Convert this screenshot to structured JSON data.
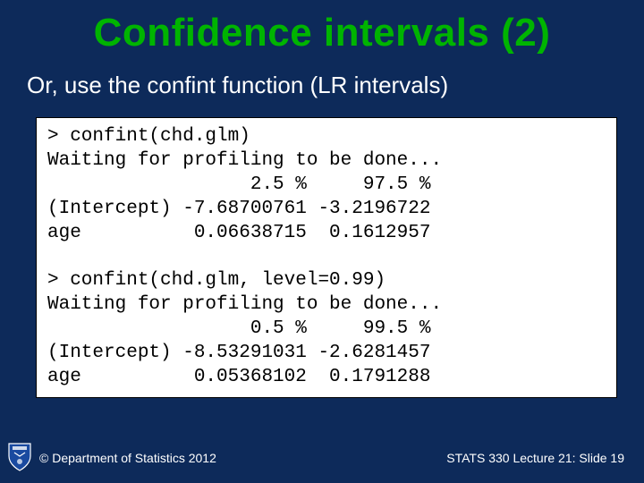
{
  "title": "Confidence intervals (2)",
  "subtitle": "Or, use the confint function (LR intervals)",
  "code": "> confint(chd.glm)\nWaiting for profiling to be done...\n                  2.5 %     97.5 %\n(Intercept) -7.68700761 -3.2196722\nage          0.06638715  0.1612957\n\n> confint(chd.glm, level=0.99)\nWaiting for profiling to be done...\n                  0.5 %     99.5 %\n(Intercept) -8.53291031 -2.6281457\nage          0.05368102  0.1791288",
  "footer": {
    "copyright": "© Department of Statistics 2012",
    "slideinfo": "STATS 330 Lecture 21: Slide 19"
  },
  "chart_data": [
    {
      "type": "table",
      "title": "confint(chd.glm)",
      "columns": [
        "2.5 %",
        "97.5 %"
      ],
      "rows": [
        {
          "name": "(Intercept)",
          "values": [
            -7.68700761,
            -3.2196722
          ]
        },
        {
          "name": "age",
          "values": [
            0.06638715,
            0.1612957
          ]
        }
      ]
    },
    {
      "type": "table",
      "title": "confint(chd.glm, level=0.99)",
      "columns": [
        "0.5 %",
        "99.5 %"
      ],
      "rows": [
        {
          "name": "(Intercept)",
          "values": [
            -8.53291031,
            -2.6281457
          ]
        },
        {
          "name": "age",
          "values": [
            0.05368102,
            0.1791288
          ]
        }
      ]
    }
  ]
}
